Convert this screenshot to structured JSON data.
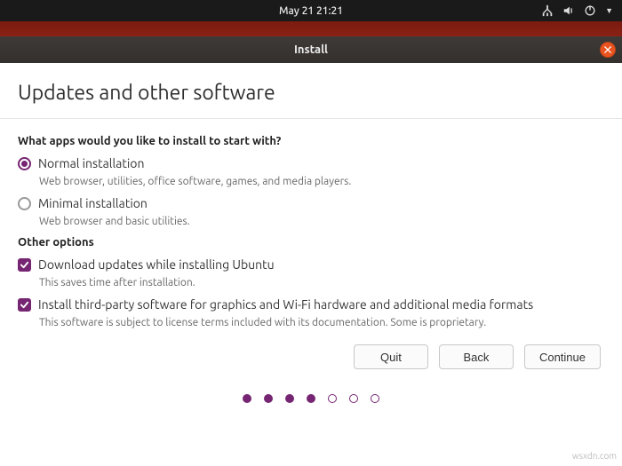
{
  "sysbar": {
    "datetime": "May 21  21:21"
  },
  "window": {
    "title": "Install"
  },
  "page": {
    "title": "Updates and other software",
    "question": "What apps would you like to install to start with?",
    "options": {
      "normal": {
        "label": "Normal installation",
        "desc": "Web browser, utilities, office software, games, and media players.",
        "selected": true
      },
      "minimal": {
        "label": "Minimal installation",
        "desc": "Web browser and basic utilities.",
        "selected": false
      }
    },
    "other_heading": "Other options",
    "checks": {
      "download_updates": {
        "label": "Download updates while installing Ubuntu",
        "desc": "This saves time after installation.",
        "checked": true
      },
      "third_party": {
        "label": "Install third-party software for graphics and Wi-Fi hardware and additional media formats",
        "desc": "This software is subject to license terms included with its documentation. Some is proprietary.",
        "checked": true
      }
    },
    "buttons": {
      "quit": "Quit",
      "back": "Back",
      "continue": "Continue"
    },
    "progress": {
      "total": 7,
      "filled": 4
    }
  },
  "watermark": "wsxdn.com"
}
